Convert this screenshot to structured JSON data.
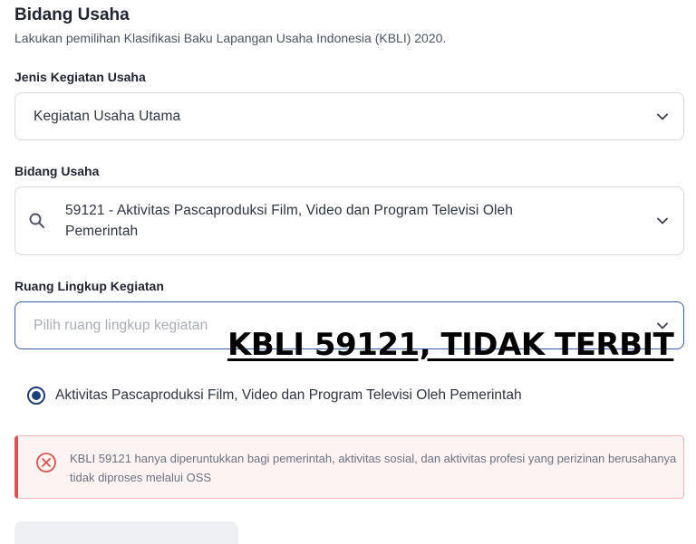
{
  "section": {
    "title": "Bidang Usaha",
    "subtitle": "Lakukan pemilihan Klasifikasi Baku Lapangan Usaha Indonesia (KBLI) 2020."
  },
  "jenis_kegiatan": {
    "label": "Jenis Kegiatan Usaha",
    "value": "Kegiatan Usaha Utama"
  },
  "bidang_usaha": {
    "label": "Bidang Usaha",
    "value_line1": "59121 - Aktivitas Pascaproduksi Film, Video dan Program Televisi Oleh",
    "value_line2": "Pemerintah"
  },
  "ruang_lingkup": {
    "label": "Ruang Lingkup Kegiatan",
    "placeholder": "Pilih ruang lingkup kegiatan"
  },
  "overlay": {
    "text": "KBLI 59121, TIDAK TERBIT"
  },
  "radio_option": {
    "label": "Aktivitas Pascaproduksi Film, Video dan Program Televisi Oleh Pemerintah",
    "selected": true
  },
  "alert": {
    "message": "KBLI 59121 hanya diperuntukkan bagi pemerintah, aktivitas sosial, dan aktivitas profesi yang perizinan berusahanya tidak diproses melalui OSS"
  },
  "colors": {
    "accent": "#1f3f7a",
    "focus_border": "#3a5da8",
    "error": "#d9534f",
    "error_bg": "#fdf3f3"
  },
  "icons": {
    "chevron": "chevron-down-icon",
    "search": "search-icon",
    "error": "close-circle-icon"
  }
}
